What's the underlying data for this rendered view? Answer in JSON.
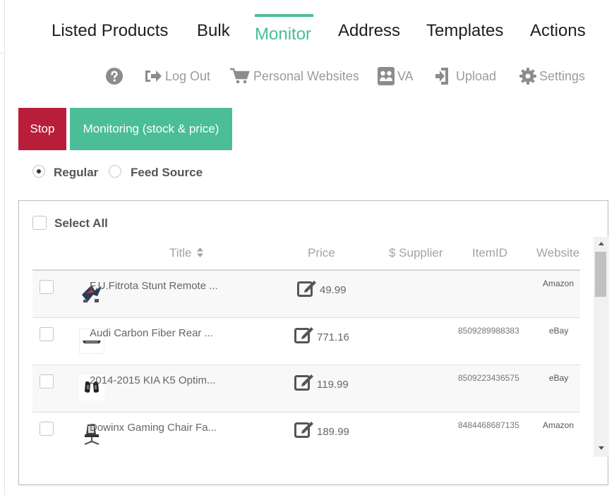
{
  "nav": {
    "tabs": [
      {
        "label": "Listed Products"
      },
      {
        "label": "Bulk"
      },
      {
        "label": "Monitor"
      },
      {
        "label": "Address"
      },
      {
        "label": "Templates"
      },
      {
        "label": "Actions"
      }
    ],
    "active_tab": "Monitor"
  },
  "subnav": {
    "help_icon": "question-circle-icon",
    "items": [
      {
        "label": "Log Out",
        "icon": "sign-out-icon"
      },
      {
        "label": "Personal Websites",
        "icon": "shopping-cart-icon"
      },
      {
        "label": "VA",
        "icon": "user-group-icon"
      },
      {
        "label": "Upload",
        "icon": "sign-in-icon"
      },
      {
        "label": "Settings",
        "icon": "gear-icon"
      }
    ]
  },
  "actions": {
    "stop_label": "Stop",
    "monitor_label": "Monitoring (stock & price)"
  },
  "source_mode": {
    "options": [
      "Regular",
      "Feed Source"
    ],
    "selected": "Regular"
  },
  "table": {
    "select_all_label": "Select All",
    "sort_icon": "sort-icon",
    "columns": [
      "Title",
      "Price",
      "$ Supplier",
      "ItemID",
      "Website"
    ],
    "rows": [
      {
        "title": "F.U.Fitrota Stunt Remote ...",
        "price": "49.99",
        "item_id": "",
        "website": "Amazon"
      },
      {
        "title": "Audi Carbon Fiber Rear ...",
        "price": "771.16",
        "item_id": "8509289988383",
        "website": "eBay"
      },
      {
        "title": "2014-2015 KIA K5 Optim...",
        "price": "119.99",
        "item_id": "8509223436575",
        "website": "eBay"
      },
      {
        "title": "Dowinx Gaming Chair Fa...",
        "price": "189.99",
        "item_id": "8484468687135",
        "website": "Amazon"
      }
    ]
  },
  "colors": {
    "accent": "#4bbd97",
    "stop": "#b81d3a",
    "muted_text": "#9b9b9b"
  }
}
